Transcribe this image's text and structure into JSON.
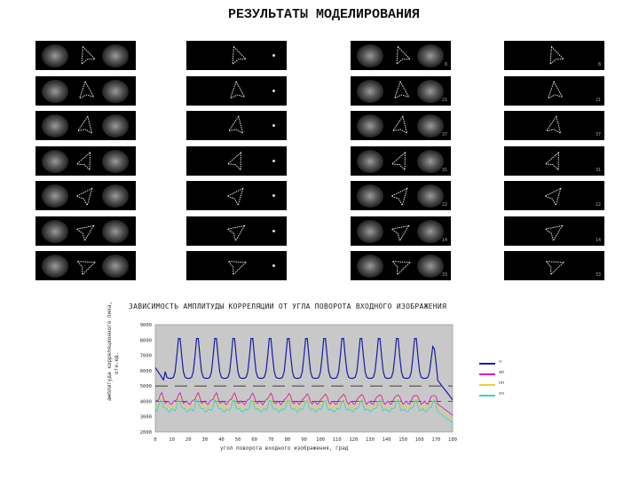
{
  "title": "РЕЗУЛЬТАТЫ МОДЕЛИРОВАНИЯ",
  "tile_columns": [
    {
      "kind": "triple",
      "tags": [
        "",
        "",
        "",
        "",
        "",
        "",
        ""
      ]
    },
    {
      "kind": "single",
      "tags": [
        "",
        "",
        "",
        "",
        "",
        "",
        ""
      ]
    },
    {
      "kind": "triple",
      "tags": [
        "8",
        "21",
        "37",
        "31",
        "22",
        "14",
        "33"
      ]
    },
    {
      "kind": "single",
      "tags": [
        "8",
        "21",
        "37",
        "31",
        "22",
        "14",
        "33"
      ]
    }
  ],
  "chart": {
    "title": "ЗАВИСИМОСТЬ АМПЛИТУДЫ КОРРЕЛЯЦИИ ОТ УГЛА ПОВОРОТА ВХОДНОГО ИЗОБРАЖЕНИЯ",
    "ylabel_line1": "амплитуда корреляционного пика,",
    "ylabel_line2": "отн.ед.",
    "xlabel": "угол поворота входного изображения, град"
  },
  "chart_data": {
    "type": "line",
    "title": "ЗАВИСИМОСТЬ АМПЛИТУДЫ КОРРЕЛЯЦИИ ОТ УГЛА ПОВОРОТА ВХОДНОГО ИЗОБРАЖЕНИЯ",
    "xlabel": "угол поворота входного изображения, град",
    "ylabel": "амплитуда корреляционного пика, отн.ед.",
    "xlim": [
      0,
      180
    ],
    "ylim": [
      2000,
      9000
    ],
    "xticks": [
      "0",
      "10",
      "20",
      "30",
      "40",
      "50",
      "60",
      "70",
      "80",
      "90",
      "100",
      "110",
      "120",
      "130",
      "140",
      "150",
      "160",
      "170",
      "180"
    ],
    "yticks": [
      "2000",
      "3000",
      "4000",
      "5000",
      "6000",
      "7000",
      "8000",
      "9000"
    ],
    "grid": "horizontal dashed",
    "legend": "right",
    "series": [
      {
        "name": "ч",
        "color": "#1a1aa6",
        "peak": 8300,
        "base": 5500
      },
      {
        "name": "ап",
        "color": "#d21cc8",
        "peak": 4500,
        "base": 3900
      },
      {
        "name": "пп",
        "color": "#e6d23c",
        "peak": 4200,
        "base": 3600
      },
      {
        "name": "оч",
        "color": "#38d2d2",
        "peak": 4000,
        "base": 3400
      }
    ]
  },
  "legend": [
    {
      "label": "ч",
      "color": "#1a1aa6"
    },
    {
      "label": "ап",
      "color": "#d21cc8"
    },
    {
      "label": "пп",
      "color": "#e6d23c"
    },
    {
      "label": "оч",
      "color": "#38d2d2"
    }
  ]
}
